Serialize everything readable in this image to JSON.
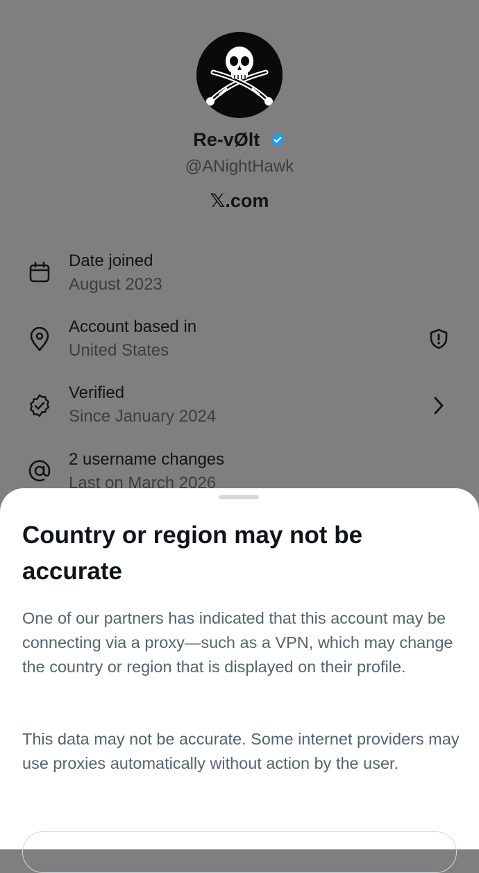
{
  "profile": {
    "display_name": "Re-vØlt",
    "handle": "@ANightHawk",
    "site": "𝕏.com"
  },
  "about": [
    {
      "icon": "calendar-icon",
      "title": "Date joined",
      "subtitle": "August 2023"
    },
    {
      "icon": "location-pin-icon",
      "title": "Account based in",
      "subtitle": "United States",
      "right_icon": "shield-alert-icon"
    },
    {
      "icon": "verified-badge-icon",
      "title": "Verified",
      "subtitle": "Since January 2024",
      "right_icon": "chevron-right-icon"
    },
    {
      "icon": "at-sign-icon",
      "title": "2 username changes",
      "subtitle": "Last on March 2026"
    }
  ],
  "sheet": {
    "title": "Country or region may not be accurate",
    "paragraph1": "One of our partners has indicated that this account may be connecting via a proxy—such as a VPN, which may change the country or region that is displayed on their profile.",
    "paragraph2": "This data may not be accurate. Some internet providers may use proxies automatically without action by the user."
  },
  "colors": {
    "overlay_background": "#7f7f7f",
    "verified_blue": "#1d9bf0",
    "sheet_background": "#ffffff",
    "secondary_text": "#536471"
  }
}
